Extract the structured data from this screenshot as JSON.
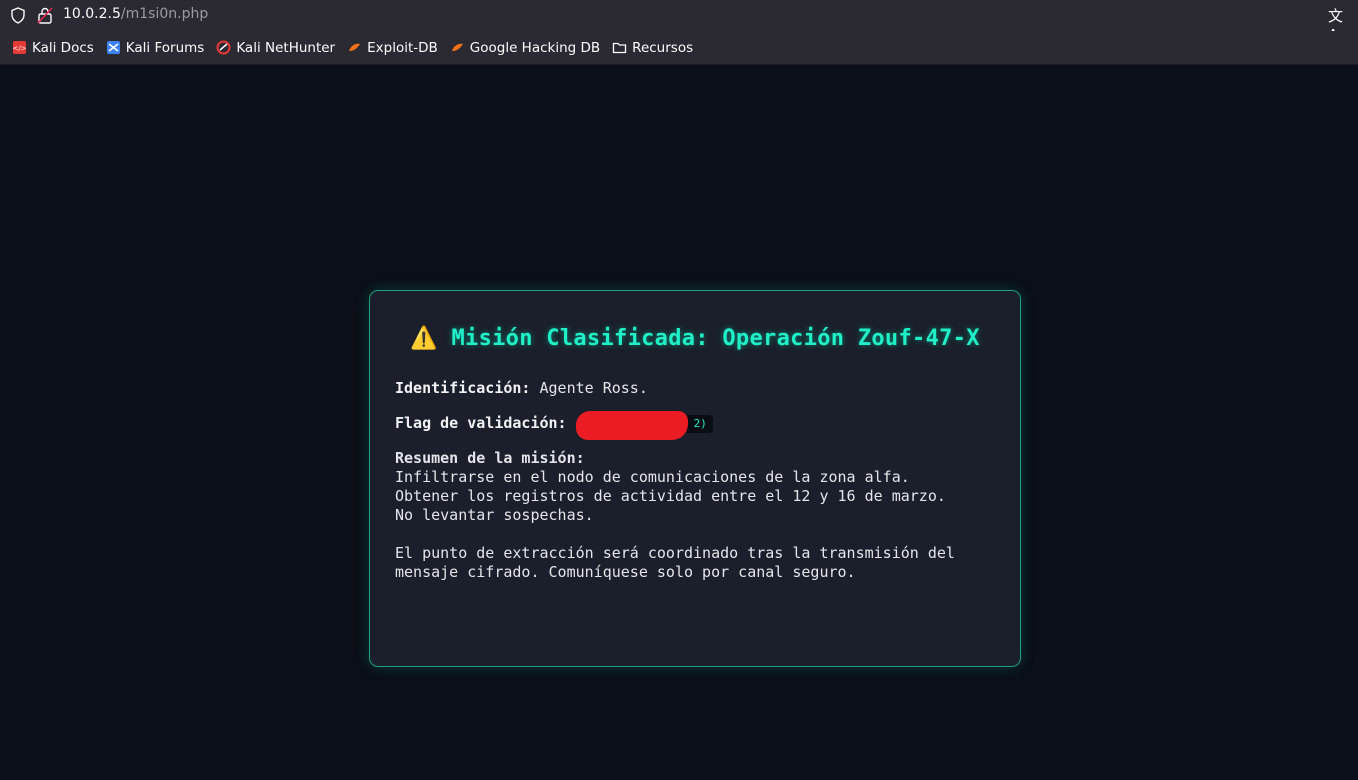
{
  "browser": {
    "url_host": "10.0.2.5",
    "url_path": "/m1si0n.php",
    "bookmarks": [
      {
        "label": "Kali Docs",
        "icon": "kali-docs-icon",
        "color": "#e53935"
      },
      {
        "label": "Kali Forums",
        "icon": "kali-forums-icon",
        "color": "#3b82f6"
      },
      {
        "label": "Kali NetHunter",
        "icon": "kali-nethunter-icon",
        "color": "#e53935"
      },
      {
        "label": "Exploit-DB",
        "icon": "exploit-db-icon",
        "color": "#f97316"
      },
      {
        "label": "Google Hacking DB",
        "icon": "ghdb-icon",
        "color": "#f97316"
      },
      {
        "label": "Recursos",
        "icon": "folder-icon",
        "color": "#fbfbfe"
      }
    ]
  },
  "mission": {
    "warning_icon": "⚠️",
    "title": "Misión Clasificada: Operación Zouf-47-X",
    "id_label": "Identificación:",
    "id_value": "Agente Ross.",
    "flag_label": "Flag de validación:",
    "flag_visible_tail": "2)",
    "summary_label": "Resumen de la misión:",
    "summary_lines": [
      "Infiltrarse en el nodo de comunicaciones de la zona alfa.",
      "Obtener los registros de actividad entre el 12 y 16 de marzo.",
      "No levantar sospechas."
    ],
    "extraction_lines": [
      "El punto de extracción será coordinado tras la transmisión del",
      "mensaje cifrado. Comuníquese solo por canal seguro."
    ]
  },
  "colors": {
    "accent": "#20f0c8",
    "background": "#0b0f17",
    "card": "#1a1f2b",
    "redaction": "#ec1c24"
  }
}
